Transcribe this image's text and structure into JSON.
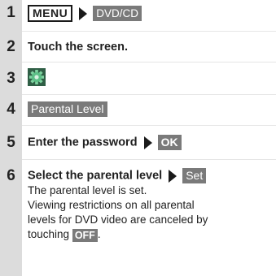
{
  "steps": [
    {
      "number": "1",
      "menu_button": "MENU",
      "dvd_button": "DVD/CD"
    },
    {
      "number": "2",
      "text": "Touch the screen."
    },
    {
      "number": "3",
      "icon": "gear-settings-icon"
    },
    {
      "number": "4",
      "button": "Parental Level"
    },
    {
      "number": "5",
      "text": "Enter the password",
      "button": "OK"
    },
    {
      "number": "6",
      "text": "Select the parental level",
      "button": "Set",
      "result": "The parental level is set.",
      "note_line1": "Viewing restrictions on all parental",
      "note_line2": "levels for DVD video are canceled by",
      "note_line3": "touching",
      "note_button": "OFF",
      "note_end": "."
    }
  ],
  "colors": {
    "number_column": "#dcdcdc",
    "button_fill": "#7a7a7a",
    "gear_green": "#3c9a5a"
  }
}
